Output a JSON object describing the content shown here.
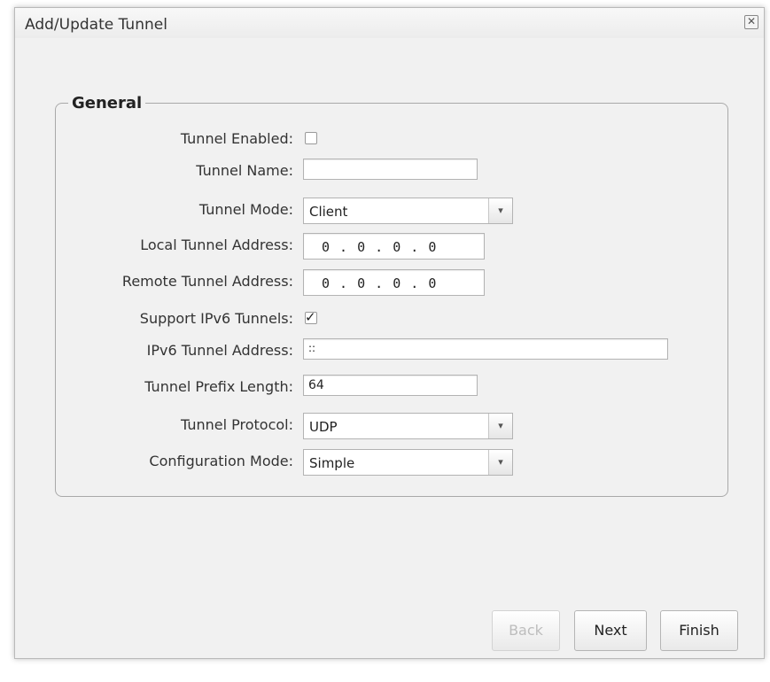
{
  "dialog": {
    "title": "Add/Update Tunnel",
    "close_symbol": "✕"
  },
  "general": {
    "legend": "General",
    "fields": {
      "tunnel_enabled": {
        "label": "Tunnel Enabled:",
        "checked": false
      },
      "tunnel_name": {
        "label": "Tunnel Name:",
        "value": ""
      },
      "tunnel_mode": {
        "label": "Tunnel Mode:",
        "value": "Client"
      },
      "local_tunnel_address": {
        "label": "Local Tunnel Address:",
        "value": "0 . 0 . 0 . 0"
      },
      "remote_tunnel_address": {
        "label": "Remote Tunnel Address:",
        "value": "0 . 0 . 0 . 0"
      },
      "support_ipv6": {
        "label": "Support IPv6 Tunnels:",
        "checked": true,
        "check_symbol": "✓"
      },
      "ipv6_tunnel_address": {
        "label": "IPv6 Tunnel Address:",
        "value": "::"
      },
      "tunnel_prefix_length": {
        "label": "Tunnel Prefix Length:",
        "value": "64"
      },
      "tunnel_protocol": {
        "label": "Tunnel Protocol:",
        "value": "UDP"
      },
      "configuration_mode": {
        "label": "Configuration Mode:",
        "value": "Simple"
      }
    },
    "select_arrow": "▾"
  },
  "buttons": {
    "back": "Back",
    "next": "Next",
    "finish": "Finish"
  },
  "icons": {
    "close": "close-icon",
    "dropdown": "chevron-down-icon",
    "check": "check-icon"
  }
}
